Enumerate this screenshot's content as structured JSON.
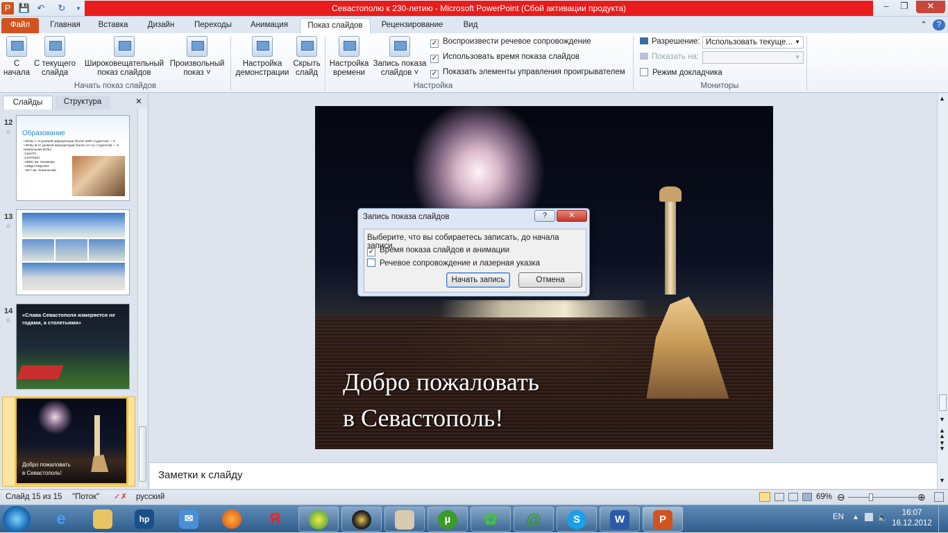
{
  "window": {
    "title": "Севастополю к 230-летию  -  Microsoft PowerPoint (Сбой активации продукта)",
    "minimize": "–",
    "maximize": "❐",
    "close": "✕"
  },
  "qat": {
    "app_icon": "P",
    "save": "💾",
    "undo": "↶",
    "redo": "↻"
  },
  "tabs": {
    "file": "Файл",
    "home": "Главная",
    "insert": "Вставка",
    "design": "Дизайн",
    "transitions": "Переходы",
    "animation": "Анимация",
    "slideshow": "Показ слайдов",
    "review": "Рецензирование",
    "view": "Вид"
  },
  "ribbon": {
    "from_start": {
      "l1": "С",
      "l2": "начала"
    },
    "from_current": {
      "l1": "С текущего",
      "l2": "слайда"
    },
    "broadcast": {
      "l1": "Широковещательный",
      "l2": "показ слайдов"
    },
    "custom": {
      "l1": "Произвольный",
      "l2": "показ ˅"
    },
    "group_start": "Начать показ слайдов",
    "setup": {
      "l1": "Настройка",
      "l2": "демонстрации"
    },
    "hide": {
      "l1": "Скрыть",
      "l2": "слайд"
    },
    "rehearse": {
      "l1": "Настройка",
      "l2": "времени"
    },
    "record": {
      "l1": "Запись показа",
      "l2": "слайдов ˅"
    },
    "chk_narration": "Воспроизвести речевое сопровождение",
    "chk_timings": "Использовать время показа слайдов",
    "chk_controls": "Показать элементы управления проигрывателем",
    "group_setup": "Настройка",
    "resolution_label": "Разрешение:",
    "resolution_value": "Использовать текуще...",
    "showon_label": "Показать на:",
    "presenter_view": "Режим докладчика",
    "group_monitors": "Мониторы"
  },
  "panel": {
    "tab_slides": "Слайды",
    "tab_outline": "Структура",
    "close": "✕"
  },
  "thumbs": [
    {
      "num": "12",
      "title": "Образование",
      "lines": [
        "• ВУЗы I—II уровней аккредитации (более 3000 студентов) — 5",
        "• ВУЗы III-IV уровней аккредитации (более 14 тыс студентов) — 5",
        "Наибольшие ВУЗы:",
        "-СевНТУ",
        "-СНУЯЭиП",
        "-АВМС им. Нахимова",
        "-СИБД УАБД НБУ",
        "- МГУ им. Ломоносова"
      ]
    },
    {
      "num": "13"
    },
    {
      "num": "14",
      "caption": "«Слава Севастополя измеряется не годами, а столетьями»"
    },
    {
      "num": "15",
      "caption1": "Добро пожаловать",
      "caption2": "в Севастополь!"
    }
  ],
  "slide": {
    "line1": "Добро пожаловать",
    "line2": "в Севастополь!"
  },
  "dialog": {
    "title": "Запись показа слайдов",
    "help": "?",
    "close": "✕",
    "prompt": "Выберите, что вы собираетесь записать, до начала записи.",
    "opt1": "Время показа слайдов и анимации",
    "opt1_checked": true,
    "opt2": "Речевое сопровождение и лазерная указка",
    "opt2_checked": false,
    "start": "Начать запись",
    "cancel": "Отмена"
  },
  "notes": {
    "placeholder": "Заметки к слайду"
  },
  "status": {
    "slide": "Слайд 15 из 15",
    "theme": "\"Поток\"",
    "language": "русский",
    "zoom": "69%",
    "zoom_value": 69
  },
  "tray": {
    "lang": "EN",
    "time": "16:07",
    "date": "16.12.2012"
  }
}
